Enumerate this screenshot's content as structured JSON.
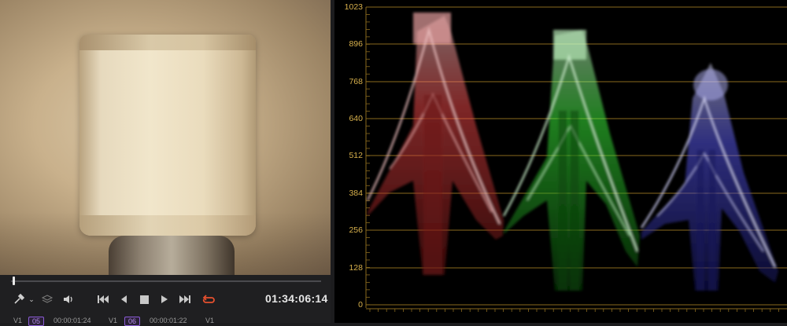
{
  "viewer": {
    "scene": "lamp"
  },
  "transport": {
    "timecode": "01:34:06:14",
    "progress": 0.01,
    "icons": [
      "eyedropper-icon",
      "chevron-down-icon",
      "layers-icon",
      "volume-icon",
      "skip-to-start-icon",
      "step-back-icon",
      "stop-icon",
      "play-icon",
      "skip-to-end-icon",
      "loop-icon"
    ],
    "loop_color": "#e6502e"
  },
  "clips": [
    {
      "track": "V1",
      "badge": "05",
      "tc": "00:00:01:24"
    },
    {
      "track": "V1",
      "badge": "06",
      "tc": "00:00:01:22"
    },
    {
      "track": "V1",
      "badge": "",
      "tc": ""
    }
  ],
  "scope": {
    "type": "RGB Parade",
    "y_ticks": [
      "1023",
      "896",
      "768",
      "640",
      "512",
      "384",
      "256",
      "128",
      "0"
    ],
    "grid_color": "#8a6a1e",
    "label_color": "#d7b04c",
    "channels": [
      {
        "name": "red",
        "color": "#ff4a4a"
      },
      {
        "name": "green",
        "color": "#3cff3c"
      },
      {
        "name": "blue",
        "color": "#5a5aff"
      }
    ]
  }
}
